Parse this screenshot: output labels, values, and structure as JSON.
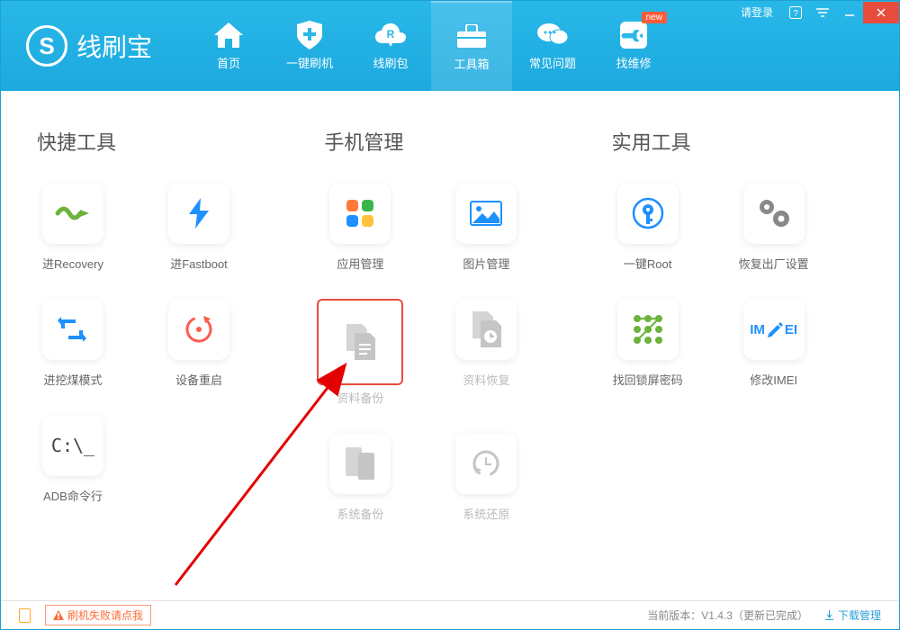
{
  "app": {
    "logo_letter": "S",
    "title": "线刷宝",
    "login_text": "请登录"
  },
  "nav": [
    {
      "label": "首页",
      "icon": "home"
    },
    {
      "label": "一键刷机",
      "icon": "shield-plus"
    },
    {
      "label": "线刷包",
      "icon": "cloud-r"
    },
    {
      "label": "工具箱",
      "icon": "toolbox",
      "active": true
    },
    {
      "label": "常见问题",
      "icon": "chat"
    },
    {
      "label": "找维修",
      "icon": "wrench",
      "badge": "new"
    }
  ],
  "sections": [
    {
      "title": "快捷工具",
      "items": [
        {
          "label": "进Recovery",
          "icon": "snake"
        },
        {
          "label": "进Fastboot",
          "icon": "flash"
        },
        {
          "label": "进挖煤模式",
          "icon": "reload-arrows"
        },
        {
          "label": "设备重启",
          "icon": "restart"
        },
        {
          "label": "ADB命令行",
          "icon": "terminal",
          "terminal_text": "C:\\_"
        }
      ]
    },
    {
      "title": "手机管理",
      "items": [
        {
          "label": "应用管理",
          "icon": "apps"
        },
        {
          "label": "图片管理",
          "icon": "picture"
        },
        {
          "label": "资料备份",
          "icon": "file-backup",
          "disabled": true,
          "highlighted": true
        },
        {
          "label": "资料恢复",
          "icon": "file-restore",
          "disabled": true
        },
        {
          "label": "系统备份",
          "icon": "system-backup",
          "disabled": true
        },
        {
          "label": "系统还原",
          "icon": "system-restore",
          "disabled": true
        }
      ]
    },
    {
      "title": "实用工具",
      "items": [
        {
          "label": "一键Root",
          "icon": "key-shield"
        },
        {
          "label": "恢复出厂设置",
          "icon": "gears"
        },
        {
          "label": "找回锁屏密码",
          "icon": "pattern"
        },
        {
          "label": "修改IMEI",
          "icon": "imei",
          "imei_text_left": "IM",
          "imei_text_right": "EI"
        }
      ]
    }
  ],
  "status": {
    "warning": "刷机失败请点我",
    "version_label": "当前版本：V1.4.3（更新已完成）",
    "download_link": "下载管理"
  }
}
